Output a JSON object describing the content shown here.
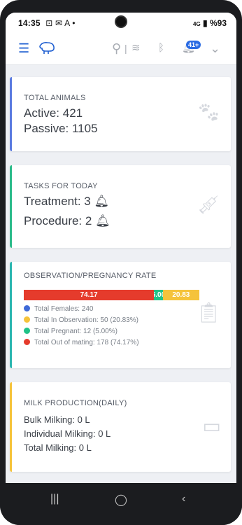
{
  "status": {
    "time": "14:35",
    "left_icons": "⊡ ✉ A •",
    "battery": "%93",
    "network": "4G"
  },
  "appbar": {
    "badge": "41+"
  },
  "cards": {
    "animals": {
      "title": "TOTAL ANIMALS",
      "active": "Active: 421",
      "passive": "Passive: 1105",
      "accent": "#5b7be0"
    },
    "tasks": {
      "title": "TASKS FOR TODAY",
      "treatment": "Treatment: 3",
      "procedure": "Procedure: 2",
      "accent": "#2bbb8a"
    },
    "observation": {
      "title": "OBSERVATION/PREGNANCY RATE",
      "accent": "#2bb6b0",
      "bar": [
        {
          "label": "74.17",
          "value": 74.17,
          "color": "#e53b2c"
        },
        {
          "label": "5.00",
          "value": 5.0,
          "color": "#20c287"
        },
        {
          "label": "20.83",
          "value": 20.83,
          "color": "#f5c33b"
        }
      ],
      "legend": [
        {
          "text": "Total Females: 240",
          "color": "#3f6ad8"
        },
        {
          "text": "Total In Observation: 50 (20.83%)",
          "color": "#f5c33b"
        },
        {
          "text": "Total Pregnant: 12 (5.00%)",
          "color": "#20c287"
        },
        {
          "text": "Total Out of mating: 178 (74.17%)",
          "color": "#e53b2c"
        }
      ]
    },
    "milk": {
      "title": "MILK PRODUCTION(DAILY)",
      "bulk": "Bulk Milking: 0 L",
      "individual": "Individual Milking: 0 L",
      "total": "Total Milking: 0 L",
      "accent": "#f5c33b"
    }
  }
}
